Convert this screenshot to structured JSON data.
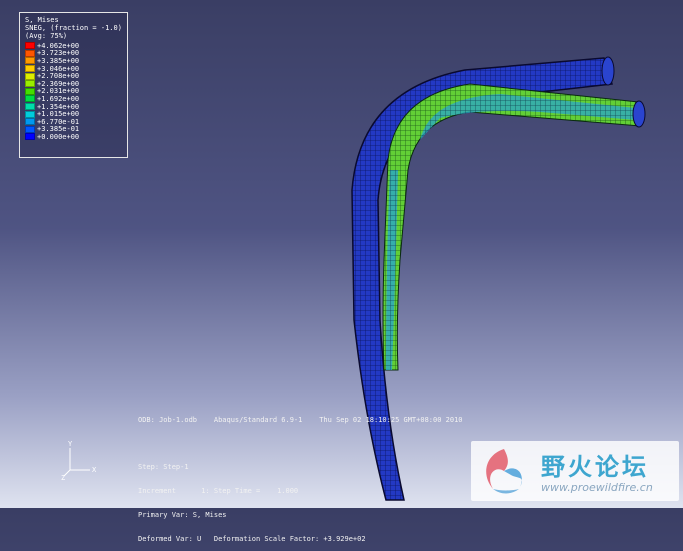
{
  "legend": {
    "title": "S, Mises",
    "subtitle": "SNEG, (fraction = -1.0)",
    "avg": "(Avg: 75%)",
    "entries": [
      {
        "label": "+4.062e+00",
        "color": "#ff0000"
      },
      {
        "label": "+3.723e+00",
        "color": "#ff5500"
      },
      {
        "label": "+3.385e+00",
        "color": "#ff9900"
      },
      {
        "label": "+3.046e+00",
        "color": "#ffcc00"
      },
      {
        "label": "+2.708e+00",
        "color": "#ddee00"
      },
      {
        "label": "+2.369e+00",
        "color": "#99ee00"
      },
      {
        "label": "+2.031e+00",
        "color": "#44dd00"
      },
      {
        "label": "+1.692e+00",
        "color": "#00dd44"
      },
      {
        "label": "+1.354e+00",
        "color": "#00ddaa"
      },
      {
        "label": "+1.015e+00",
        "color": "#00ccdd"
      },
      {
        "label": "+6.770e-01",
        "color": "#0099ee"
      },
      {
        "label": "+3.385e-01",
        "color": "#0055ff"
      },
      {
        "label": "+0.000e+00",
        "color": "#0000ff"
      }
    ]
  },
  "info": {
    "odb_line": "ODB: Job-1.odb    Abaqus/Standard 6.9-1    Thu Sep 02 18:10:25 GMT+08:00 2010",
    "step": "Step: Step-1",
    "increment": "Increment      1: Step Time =    1.000",
    "primary": "Primary Var: S, Mises",
    "deformed": "Deformed Var: U   Deformation Scale Factor: +3.929e+02"
  },
  "triad": {
    "x": "X",
    "y": "Y",
    "z": "Z"
  },
  "watermark": {
    "cn": "野火论坛",
    "url": "www.proewildfire.cn"
  },
  "colors": {
    "mesh_dark": "#1f2fae",
    "mesh_mid": "#2c46d4",
    "green": "#5fd23a",
    "edge": "#0a0a30"
  }
}
